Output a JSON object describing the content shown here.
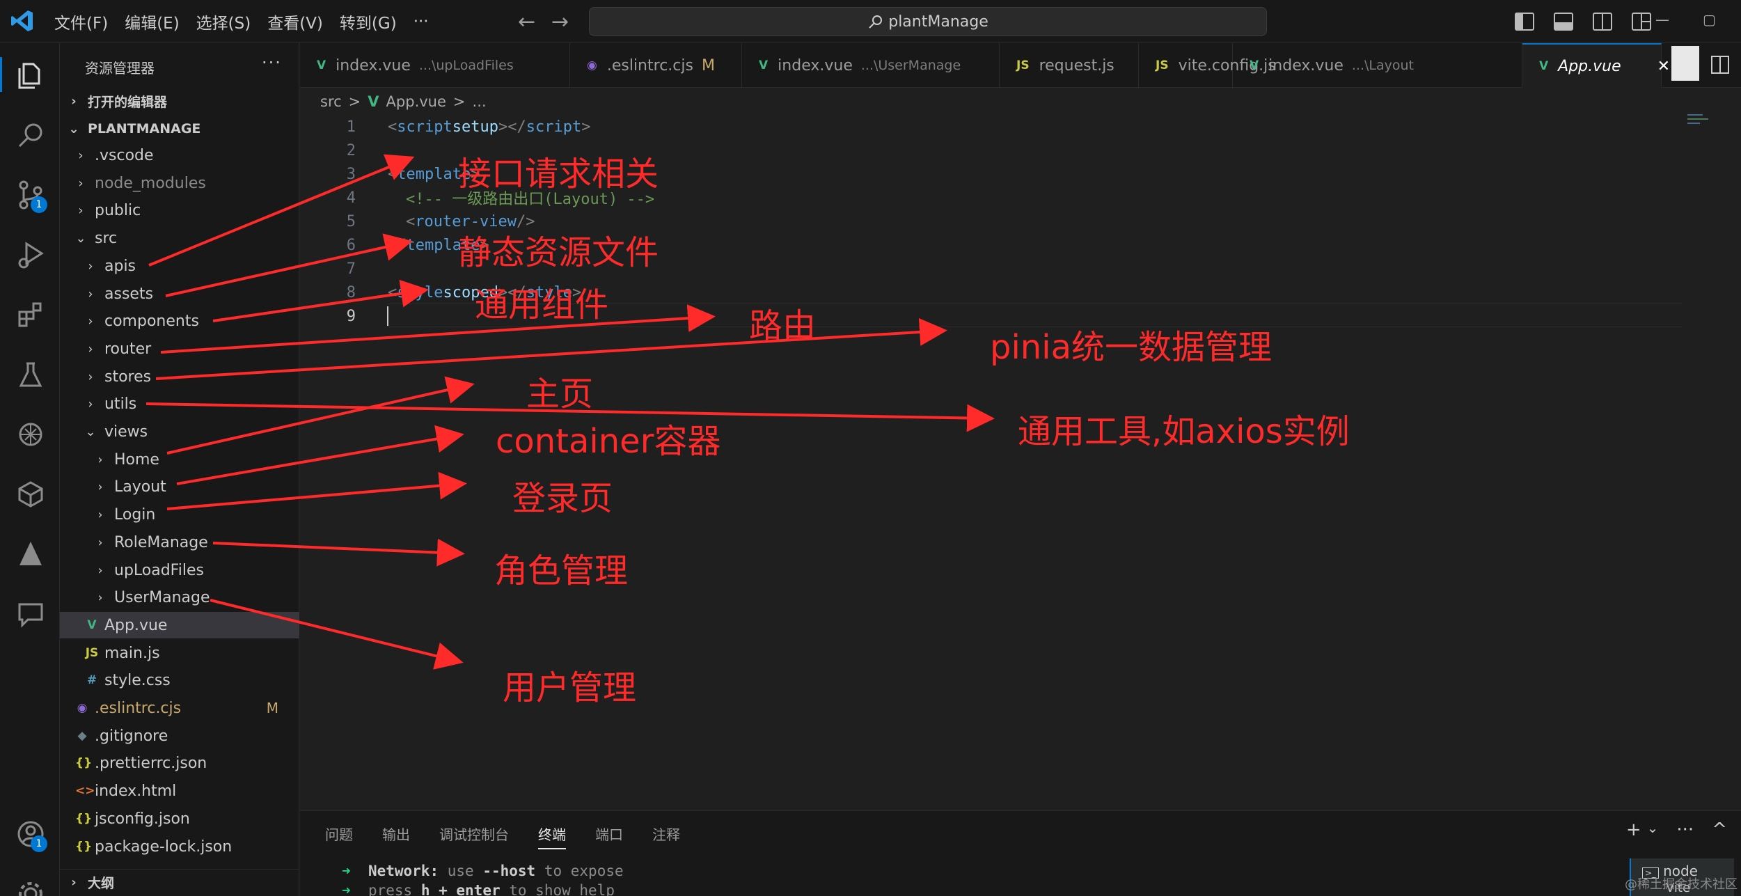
{
  "titlebar": {
    "menu": [
      "文件(F)",
      "编辑(E)",
      "选择(S)",
      "查看(V)",
      "转到(G)",
      "···"
    ],
    "search": "plantManage",
    "nav_back": "←",
    "nav_forward": "→",
    "window_controls": [
      "—",
      "▢",
      "✕"
    ]
  },
  "activitybar": {
    "icons": [
      "explorer-icon",
      "search-icon",
      "source-control-icon",
      "run-debug-icon",
      "extensions-icon",
      "testing-icon",
      "openai-icon",
      "box-icon",
      "tree-icon",
      "comment-icon",
      "account-icon",
      "settings-icon"
    ],
    "badges": {
      "source_control": "1",
      "account": "1"
    }
  },
  "sidebar": {
    "title": "资源管理器",
    "more": "···",
    "open_editors": "打开的编辑器",
    "project": "PLANTMANAGE",
    "items": [
      {
        "label": ".vscode",
        "type": "folder",
        "level": 1,
        "open": false
      },
      {
        "label": "node_modules",
        "type": "folder",
        "level": 1,
        "open": false,
        "dim": true
      },
      {
        "label": "public",
        "type": "folder",
        "level": 1,
        "open": false
      },
      {
        "label": "src",
        "type": "folder",
        "level": 1,
        "open": true
      },
      {
        "label": "apis",
        "type": "folder",
        "level": 2,
        "open": false
      },
      {
        "label": "assets",
        "type": "folder",
        "level": 2,
        "open": false
      },
      {
        "label": "components",
        "type": "folder",
        "level": 2,
        "open": false
      },
      {
        "label": "router",
        "type": "folder",
        "level": 2,
        "open": false
      },
      {
        "label": "stores",
        "type": "folder",
        "level": 2,
        "open": false
      },
      {
        "label": "utils",
        "type": "folder",
        "level": 2,
        "open": false
      },
      {
        "label": "views",
        "type": "folder",
        "level": 2,
        "open": true
      },
      {
        "label": "Home",
        "type": "folder",
        "level": 3,
        "open": false
      },
      {
        "label": "Layout",
        "type": "folder",
        "level": 3,
        "open": false
      },
      {
        "label": "Login",
        "type": "folder",
        "level": 3,
        "open": false
      },
      {
        "label": "RoleManage",
        "type": "folder",
        "level": 3,
        "open": false
      },
      {
        "label": "upLoadFiles",
        "type": "folder",
        "level": 3,
        "open": false
      },
      {
        "label": "UserManage",
        "type": "folder",
        "level": 3,
        "open": false
      },
      {
        "label": "App.vue",
        "type": "vue",
        "level": 2,
        "selected": true
      },
      {
        "label": "main.js",
        "type": "js",
        "level": 2
      },
      {
        "label": "style.css",
        "type": "css",
        "level": 2
      },
      {
        "label": ".eslintrc.cjs",
        "type": "eslint",
        "level": 1,
        "git": "M"
      },
      {
        "label": ".gitignore",
        "type": "git",
        "level": 1
      },
      {
        "label": ".prettierrc.json",
        "type": "json",
        "level": 1
      },
      {
        "label": "index.html",
        "type": "html",
        "level": 1
      },
      {
        "label": "jsconfig.json",
        "type": "json",
        "level": 1
      },
      {
        "label": "package-lock.json",
        "type": "json",
        "level": 1
      }
    ],
    "outline": "大纲"
  },
  "tabs": [
    {
      "label": "index.vue",
      "sub": "...\\upLoadFiles",
      "icon": "vue"
    },
    {
      "label": ".eslintrc.cjs",
      "sub": "",
      "icon": "eslint",
      "mark": "M"
    },
    {
      "label": "index.vue",
      "sub": "...\\UserManage",
      "icon": "vue"
    },
    {
      "label": "request.js",
      "sub": "",
      "icon": "js"
    },
    {
      "label": "vite.config.js",
      "sub": "",
      "icon": "js"
    },
    {
      "label": "index.vue",
      "sub": "...\\Layout",
      "icon": "vue"
    },
    {
      "label": "App.vue",
      "sub": "",
      "icon": "vue",
      "active": true
    }
  ],
  "breadcrumb": [
    "src",
    ">",
    "App.vue",
    ">",
    "..."
  ],
  "code": {
    "line_numbers": [
      "1",
      "2",
      "3",
      "4",
      "5",
      "6",
      "7",
      "8",
      "9"
    ],
    "l1": {
      "open": "<",
      "tag": "script",
      "attr": " setup",
      "close": "></",
      "tag2": "script",
      "end": ">"
    },
    "l3": {
      "open": "<",
      "tag": "template",
      "end": ">"
    },
    "l4": {
      "comment": "<!-- 一级路由出口(Layout) -->"
    },
    "l5": {
      "open": "<",
      "tag": "router-view",
      "end": " />"
    },
    "l6": {
      "open": "</",
      "tag": "template",
      "end": ">"
    },
    "l8": {
      "open": "<",
      "tag": "style",
      "attr": " scoped",
      "close": "></",
      "tag2": "style",
      "end": ">"
    }
  },
  "panel": {
    "tabs": [
      "问题",
      "输出",
      "调试控制台",
      "终端",
      "端口",
      "注释"
    ],
    "active_tab": "终端",
    "actions": [
      "+",
      "⌄",
      "···",
      "^"
    ],
    "term_l1": {
      "arrow": "➜",
      "label": "Network:",
      "t1": " use ",
      "flag": "--host",
      "t2": " to expose"
    },
    "term_l2": {
      "arrow": "➜",
      "t1": "press ",
      "key": "h + enter",
      "t2": " to show help"
    },
    "terminal_name": "node",
    "terminal_name2": "Vite"
  },
  "watermark": "@稀土掘金技术社区",
  "annotations": {
    "apis": "接口请求相关",
    "assets": "静态资源文件",
    "components": "通用组件",
    "router": "路由",
    "stores": "pinia统一数据管理",
    "home": "主页",
    "utils": "通用工具,如axios实例",
    "layout": "container容器",
    "login": "登录页",
    "role": "角色管理",
    "user": "用户管理"
  },
  "colors": {
    "annotation": "#ff2a2a",
    "accent": "#0078d4",
    "vue": "#41b883",
    "js": "#cbcb41"
  }
}
